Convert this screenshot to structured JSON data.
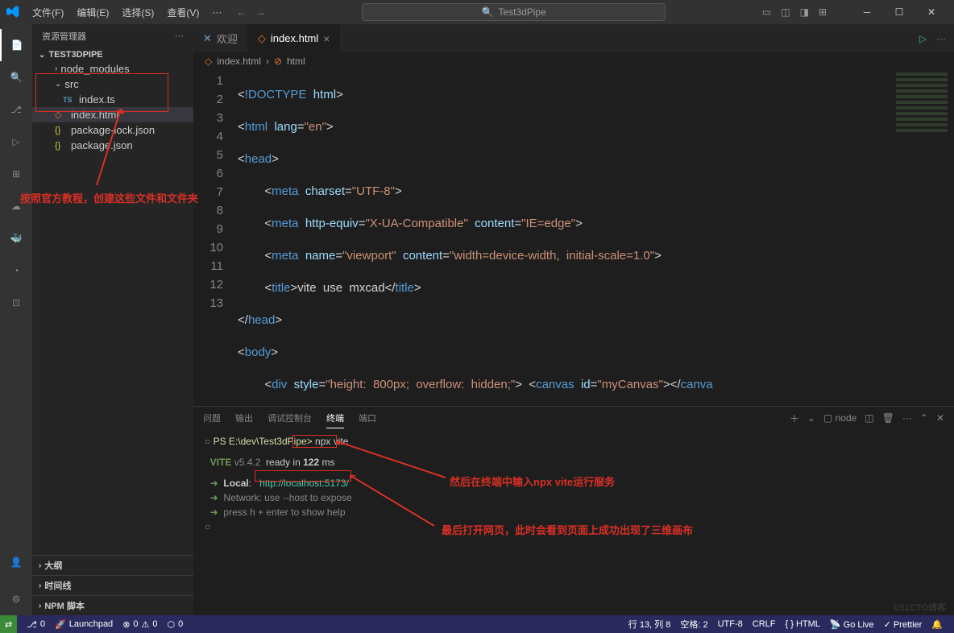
{
  "window": {
    "search_text": "Test3dPipe"
  },
  "menus": [
    "文件(F)",
    "编辑(E)",
    "选择(S)",
    "查看(V)",
    "···"
  ],
  "sidebar": {
    "title": "资源管理器",
    "project": "TEST3DPIPE",
    "files": [
      {
        "label": "node_modules",
        "type": "folder",
        "nest": 0,
        "chev": "›"
      },
      {
        "label": "src",
        "type": "folder",
        "nest": 0,
        "chev": "⌄"
      },
      {
        "label": "index.ts",
        "type": "ts",
        "nest": 1
      },
      {
        "label": "index.html",
        "type": "html",
        "nest": 0,
        "selected": true
      },
      {
        "label": "package-lock.json",
        "type": "json",
        "nest": 0
      },
      {
        "label": "package.json",
        "type": "json",
        "nest": 0
      }
    ],
    "sections": [
      "大纲",
      "时间线",
      "NPM 脚本"
    ]
  },
  "tabs": [
    {
      "label": "欢迎",
      "icon": "✕",
      "active": false
    },
    {
      "label": "index.html",
      "icon": "◇",
      "active": true
    }
  ],
  "breadcrumbs": [
    "index.html",
    "html"
  ],
  "panel": {
    "tabs": [
      "问题",
      "输出",
      "调试控制台",
      "终端",
      "端口"
    ],
    "active": "终端",
    "shell": "node",
    "prompt_path": "PS E:\\dev\\Test3dPipe>",
    "command": "npx vite",
    "vite_banner": "VITE v5.4.2  ready in 122 ms",
    "local_label": "Local:",
    "local_url": "http://localhost:5173/",
    "network_line": "Network: use --host to expose",
    "help_line": "press h + enter to show help"
  },
  "statusbar": {
    "left": [
      {
        "icon": "⎇",
        "text": "0"
      },
      {
        "icon": "🚀",
        "text": "Launchpad"
      },
      {
        "icon": "⊗",
        "text": "0"
      },
      {
        "icon": "⚠",
        "text": "0"
      },
      {
        "icon": "⬡",
        "text": "0"
      }
    ],
    "right": [
      {
        "text": "行 13, 列 8"
      },
      {
        "text": "空格: 2"
      },
      {
        "text": "UTF-8"
      },
      {
        "text": "CRLF"
      },
      {
        "text": "{ } HTML"
      },
      {
        "text": "📡 Go Live"
      },
      {
        "text": "✓ Prettier"
      },
      {
        "text": "🔔"
      }
    ]
  },
  "annotations": {
    "a1": "按照官方教程，创建这些文件和文件夹",
    "a2": "然后在终端中输入npx vite运行服务",
    "a3": "最后打开网页，此时会看到页面上成功出现了三维画布"
  },
  "watermark": "©51CTO博客"
}
